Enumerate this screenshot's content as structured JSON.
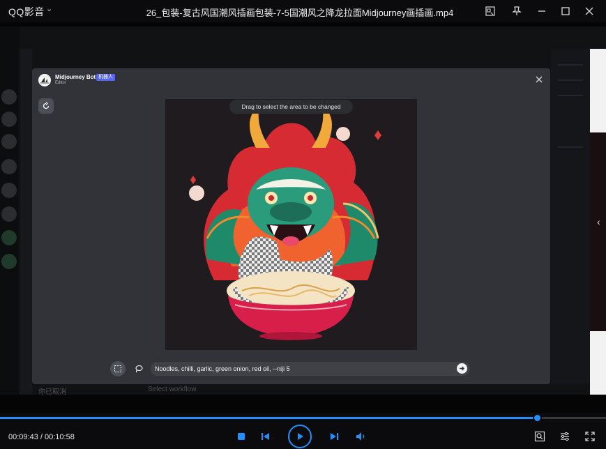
{
  "player": {
    "app_name": "QQ影音",
    "file_title": "26_包装-复古风国潮风插画包装-7-5国潮风之降龙拉面Midjourney画插画.mp4",
    "time_display": "00:09:43 / 00:10:58",
    "progress": 0.886,
    "accent": "#1e90ff"
  },
  "editor": {
    "bot_name": "Midjourney Bot",
    "bot_badge": "机器人",
    "subtitle": "Editor",
    "hint": "Drag to select the area to be changed",
    "prompt": "Noodles, chilli, garlic, green onion, red oil, --niji 5",
    "badge_color": "#5865f2"
  },
  "background": {
    "footer_left": "你已取消",
    "footer_right": "Select workflow"
  },
  "icons": {
    "titlebar": [
      "pin-icon",
      "minimize-icon",
      "maximize-icon",
      "close-icon"
    ],
    "controls": [
      "stop-icon",
      "prev-icon",
      "play-icon",
      "next-icon",
      "volume-icon",
      "screenshot-icon",
      "settings-icon",
      "fullscreen-icon"
    ]
  }
}
